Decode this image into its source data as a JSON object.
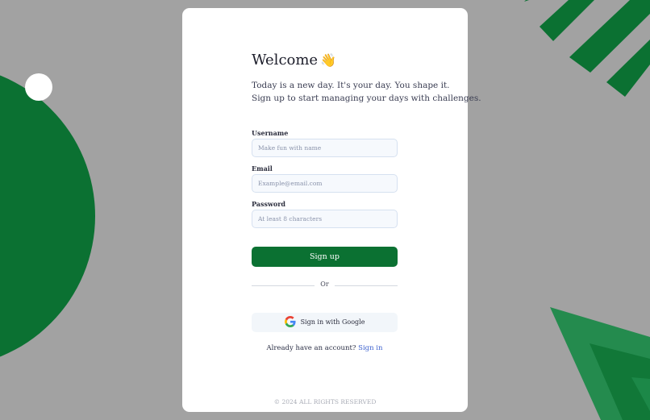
{
  "colors": {
    "page_background": "#a2a2a2",
    "brand_green": "#0b7132",
    "link_blue": "#3f63cf",
    "field_background": "#f6f9fd"
  },
  "signup": {
    "heading": "Welcome",
    "heading_emoji": "👋",
    "intro_line1": "Today is a new day. It's your day. You shape it.",
    "intro_line2": "Sign up to start managing your days with challenges.",
    "username": {
      "label": "Username",
      "placeholder": "Make fun with name",
      "value": ""
    },
    "email": {
      "label": "Email",
      "placeholder": "Example@email.com",
      "value": ""
    },
    "password": {
      "label": "Password",
      "placeholder": "At least 8 characters",
      "value": ""
    },
    "submit_label": "Sign up",
    "divider_label": "Or",
    "google": {
      "label": "Sign in with Google",
      "icon": "google-logo-icon"
    },
    "signin_prompt": "Already have an account?",
    "signin_link": "Sign in"
  },
  "footer": {
    "copyright": "© 2024 ALL RIGHTS RESERVED"
  }
}
